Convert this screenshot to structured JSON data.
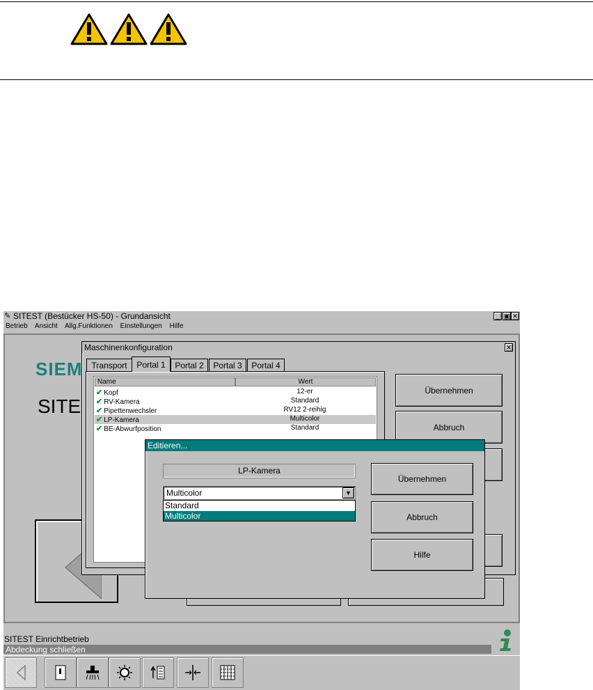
{
  "app": {
    "title": "SITEST (Bestücker HS-50) - Grundansicht",
    "menu": [
      "Betrieb",
      "Ansicht",
      "Allg.Funktionen",
      "Einstellungen",
      "Hilfe"
    ],
    "logo": "SIEMENS",
    "big_label": "SITEST"
  },
  "dialog": {
    "title": "Maschinenkonfiguration",
    "tabs": [
      "Transport",
      "Portal 1",
      "Portal 2",
      "Portal 3",
      "Portal 4"
    ],
    "active_tab": "Portal 1",
    "columns": [
      "Name",
      "Wert"
    ],
    "rows": [
      {
        "name": "Kopf",
        "value": "12-er"
      },
      {
        "name": "RV-Kamera",
        "value": "Standard"
      },
      {
        "name": "Pipettenwechsler",
        "value": "RV12 2-reihig"
      },
      {
        "name": "LP-Kamera",
        "value": "Multicolor"
      },
      {
        "name": "BE-Abwurfposition",
        "value": "Standard"
      }
    ],
    "buttons": {
      "apply": "Übernehmen",
      "cancel": "Abbruch"
    }
  },
  "edit": {
    "title": "Editieren...",
    "field_label": "LP-Kamera",
    "selected": "Multicolor",
    "options": [
      "Standard",
      "Multicolor"
    ],
    "buttons": {
      "apply": "Übernehmen",
      "cancel": "Abbruch",
      "help": "Hilfe"
    }
  },
  "status": {
    "mode": "SITEST Einrichtbetrieb",
    "message": "Abdeckung schließen"
  },
  "colors": {
    "teal": "#007b7b",
    "silver": "#c0c0c0",
    "warning": "#f5c400"
  }
}
